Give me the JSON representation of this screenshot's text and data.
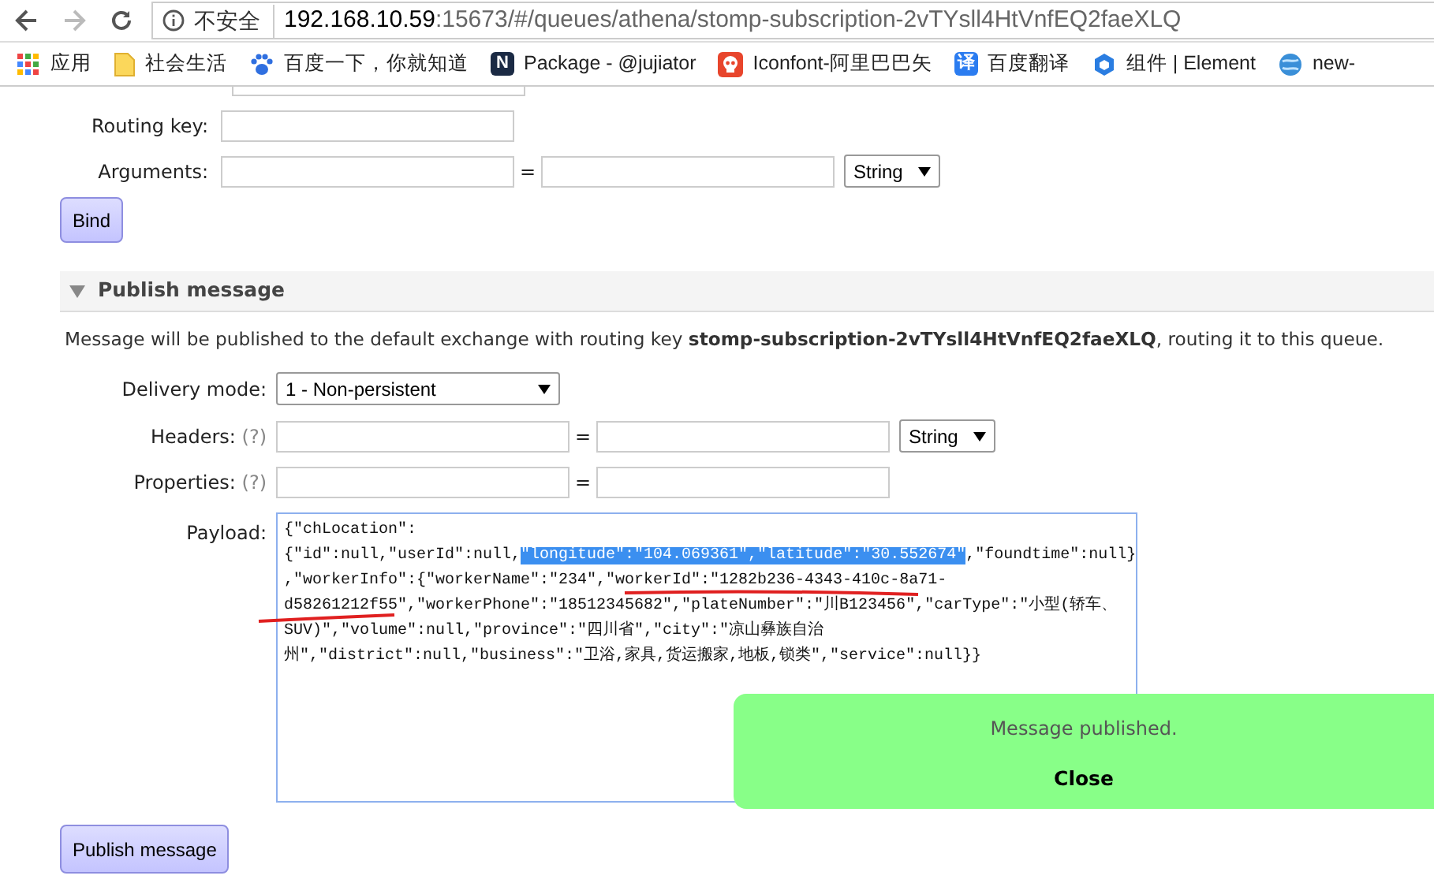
{
  "browser": {
    "back_disabled": false,
    "forward_disabled": true,
    "security": "不安全",
    "url_host": "192.168.10.59",
    "url_rest": ":15673/#/queues/athena/stomp-subscription-2vTYsll4HtVnfEQ2faeXLQ"
  },
  "bookmarks": [
    {
      "kind": "apps",
      "label": "应用"
    },
    {
      "kind": "folder",
      "label": "社会生活"
    },
    {
      "kind": "paw",
      "label": "百度一下，你就知道"
    },
    {
      "kind": "letter",
      "badge": "N",
      "label": "Package - @jujiator"
    },
    {
      "kind": "skull",
      "label": "Iconfont-阿里巴巴矢"
    },
    {
      "kind": "letter-blue",
      "badge": "译",
      "label": "百度翻译"
    },
    {
      "kind": "hex",
      "label": "组件 | Element"
    },
    {
      "kind": "globe",
      "label": "new-"
    }
  ],
  "bind_form": {
    "fields": [
      {
        "label": "Routing key:",
        "kind": "text"
      },
      {
        "label": "Arguments:",
        "kind": "pair",
        "equals": "=",
        "type_value": "String"
      }
    ],
    "button": "Bind"
  },
  "publish": {
    "title": "Publish message",
    "expanded": true,
    "description": [
      {
        "text": "Message will be published to the default exchange with routing key ",
        "bold": false
      },
      {
        "text": "stomp-subscription-2vTYsll4HtVnfEQ2faeXLQ",
        "bold": true
      },
      {
        "text": ", routing it to this queue.",
        "bold": false
      }
    ],
    "fields": [
      {
        "label": "Delivery mode:",
        "kind": "select",
        "value": "1 - Non-persistent"
      },
      {
        "label": "Headers:",
        "help": "(?)",
        "kind": "pair",
        "equals": "=",
        "type_value": "String"
      },
      {
        "label": "Properties:",
        "help": "(?)",
        "kind": "pair2",
        "equals": "="
      }
    ],
    "payload_label": "Payload:",
    "payload_lines": [
      [
        {
          "text": "{\"chLocation\":",
          "selected": false
        }
      ],
      [
        {
          "text": "{\"id\":null,\"userId\":null,",
          "selected": false
        },
        {
          "text": "\"longitude\":\"104.069361\",\"latitude\":\"30.552674\"",
          "selected": true
        },
        {
          "text": ",\"foundtime\":null}",
          "selected": false
        }
      ],
      [
        {
          "text": ",\"workerInfo\":{\"workerName\":\"234\",\"workerId\":\"1282b236-4343-410c-8a71-",
          "selected": false
        }
      ],
      [
        {
          "text": "d58261212f55\",\"workerPhone\":\"18512345682\",\"plateNumber\":\"川B123456\",\"carType\":\"小型(轿车、",
          "selected": false
        }
      ],
      [
        {
          "text": "SUV)\",\"volume\":null,\"province\":\"四川省\",\"city\":\"凉山彝族自治",
          "selected": false
        }
      ],
      [
        {
          "text": "州\",\"district\":null,\"business\":\"卫浴,家具,货运搬家,地板,锁类\",\"service\":null}}",
          "selected": false
        }
      ]
    ],
    "button": "Publish message"
  },
  "toast": {
    "message": "Message published.",
    "close": "Close"
  }
}
